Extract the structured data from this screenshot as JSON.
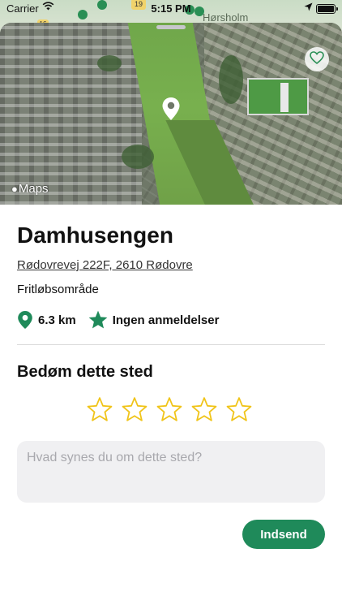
{
  "status_bar": {
    "carrier": "Carrier",
    "time": "5:15 PM",
    "icons": [
      "wifi-icon",
      "location-arrow-icon",
      "battery-icon"
    ]
  },
  "background_map": {
    "town_label": "Hørsholm",
    "road_badges": [
      "16",
      "19"
    ]
  },
  "map": {
    "attribution": "Maps",
    "favorite_icon": "heart-outline-icon",
    "pin_icon": "map-pin-icon"
  },
  "place": {
    "name": "Damhusengen",
    "address": "Rødovrevej 222F, 2610 Rødovre",
    "category": "Fritløbsområde",
    "distance": "6.3 km",
    "reviews": "Ingen anmeldelser"
  },
  "rating": {
    "title": "Bedøm dette sted",
    "max_stars": 5,
    "selected": 0
  },
  "review": {
    "placeholder": "Hvad synes du om dette sted?",
    "value": ""
  },
  "submit": {
    "label": "Indsend"
  },
  "colors": {
    "accent": "#1f8a5a",
    "star_outline": "#f0c419"
  }
}
